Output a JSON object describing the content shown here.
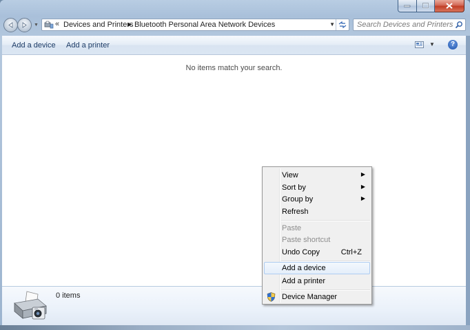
{
  "window": {
    "min_glyph": "–",
    "max_glyph": "□",
    "close_glyph": "✕"
  },
  "nav": {
    "back_glyph": "◀",
    "forward_glyph": "▶"
  },
  "address": {
    "overflow": "«",
    "crumbs": [
      "Devices and Printers",
      "Bluetooth Personal Area Network Devices"
    ],
    "separator": "▶"
  },
  "search": {
    "placeholder": "Search Devices and Printers"
  },
  "command_bar": {
    "add_device": "Add a device",
    "add_printer": "Add a printer",
    "help": "?"
  },
  "content": {
    "empty_message": "No items match your search."
  },
  "details": {
    "item_count": "0 items"
  },
  "context_menu": {
    "items": [
      {
        "label": "View",
        "submenu": true
      },
      {
        "label": "Sort by",
        "submenu": true
      },
      {
        "label": "Group by",
        "submenu": true
      },
      {
        "label": "Refresh"
      },
      {
        "label": "Paste",
        "disabled": true
      },
      {
        "label": "Paste shortcut",
        "disabled": true
      },
      {
        "label": "Undo Copy",
        "shortcut": "Ctrl+Z"
      },
      {
        "label": "Add a device",
        "highlighted": true
      },
      {
        "label": "Add a printer"
      },
      {
        "label": "Device Manager",
        "icon": "uac-shield-icon"
      }
    ]
  },
  "colors": {
    "accent_link": "#1c3b66",
    "menu_highlight_border": "#aeccf1"
  }
}
